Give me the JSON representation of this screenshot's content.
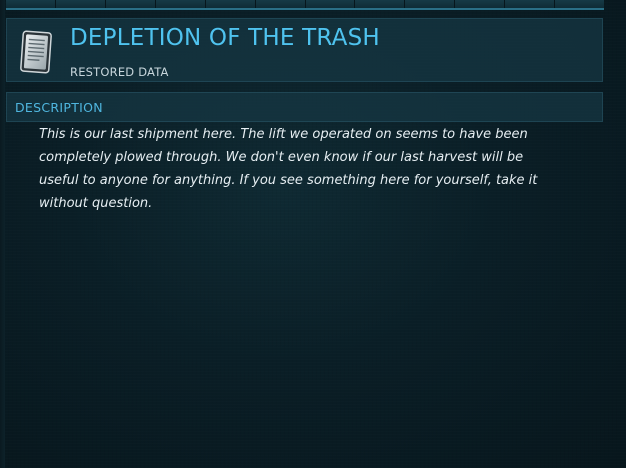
{
  "entry": {
    "title": "DEPLETION OF THE TRASH",
    "subtitle": "RESTORED DATA",
    "icon": "datapad-icon"
  },
  "section": {
    "label": "DESCRIPTION"
  },
  "description": {
    "lines": [
      "This is our last shipment here. The lift we operated on seems to have been",
      "completely plowed through. We don't even know if our last harvest will be",
      "useful to anyone for anything. If you see something here for yourself, take it",
      "without question."
    ]
  },
  "colors": {
    "accent": "#4fc3ef",
    "panel": "#163744",
    "background": "#0a1e26",
    "text": "#e6eef2"
  }
}
